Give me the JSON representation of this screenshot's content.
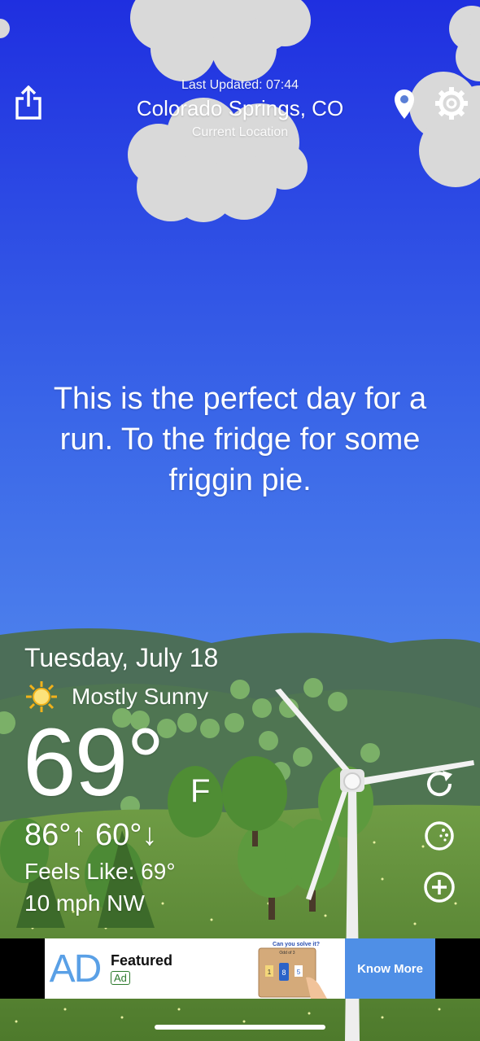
{
  "header": {
    "last_updated": "Last Updated: 07:44",
    "location": "Colorado Springs, CO",
    "location_sub": "Current Location"
  },
  "message": "This is the perfect day for a run. To the fridge for some friggin pie.",
  "weather": {
    "date": "Tuesday, July 18",
    "condition": "Mostly Sunny",
    "condition_icon": "sun-icon",
    "temperature": "69°",
    "unit": "F",
    "high": "86°",
    "low": "60°",
    "hilo": "86°↑  60°↓",
    "feels_like": "Feels Like: 69°",
    "wind": "10 mph NW"
  },
  "ad": {
    "logo": "AD",
    "featured": "Featured",
    "badge": "Ad",
    "image_caption": "Can you solve it?",
    "image_subcaption": "Odd of 3",
    "cta": "Know More"
  },
  "colors": {
    "sky_top": "#2233e0",
    "sky_bottom": "#6aaaf2",
    "hills_far": "#4c6e58",
    "grass": "#5f8e3a",
    "ad_cta": "#4f8fe6"
  }
}
